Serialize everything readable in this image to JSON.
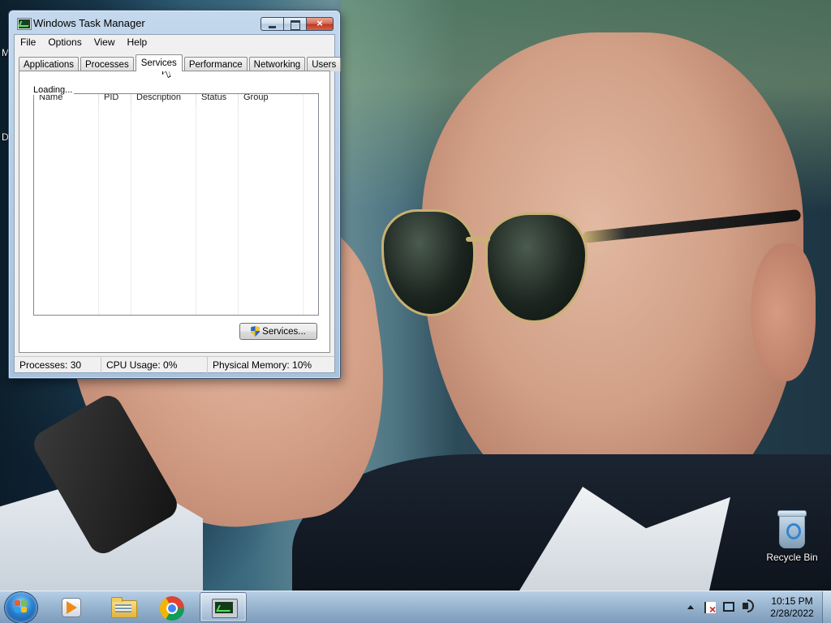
{
  "desktop": {
    "edge_letters": [
      "M",
      "D"
    ],
    "recycle_bin_label": "Recycle Bin"
  },
  "window": {
    "title": "Windows Task Manager",
    "icon": "task-manager-icon",
    "menu": [
      "File",
      "Options",
      "View",
      "Help"
    ],
    "tabs": [
      "Applications",
      "Processes",
      "Services",
      "Performance",
      "Networking",
      "Users"
    ],
    "active_tab": "Services",
    "loading_text": "Loading...",
    "columns": [
      "Name",
      "PID",
      "Description",
      "Status",
      "Group"
    ],
    "services_button_label": "Services...",
    "status": {
      "processes": "Processes: 30",
      "cpu": "CPU Usage: 0%",
      "memory": "Physical Memory: 10%"
    }
  },
  "taskbar": {
    "pinned": [
      "media-player-icon",
      "file-explorer-icon",
      "chrome-icon",
      "task-manager-icon"
    ],
    "clock_time": "10:15 PM",
    "clock_date": "2/28/2022"
  }
}
